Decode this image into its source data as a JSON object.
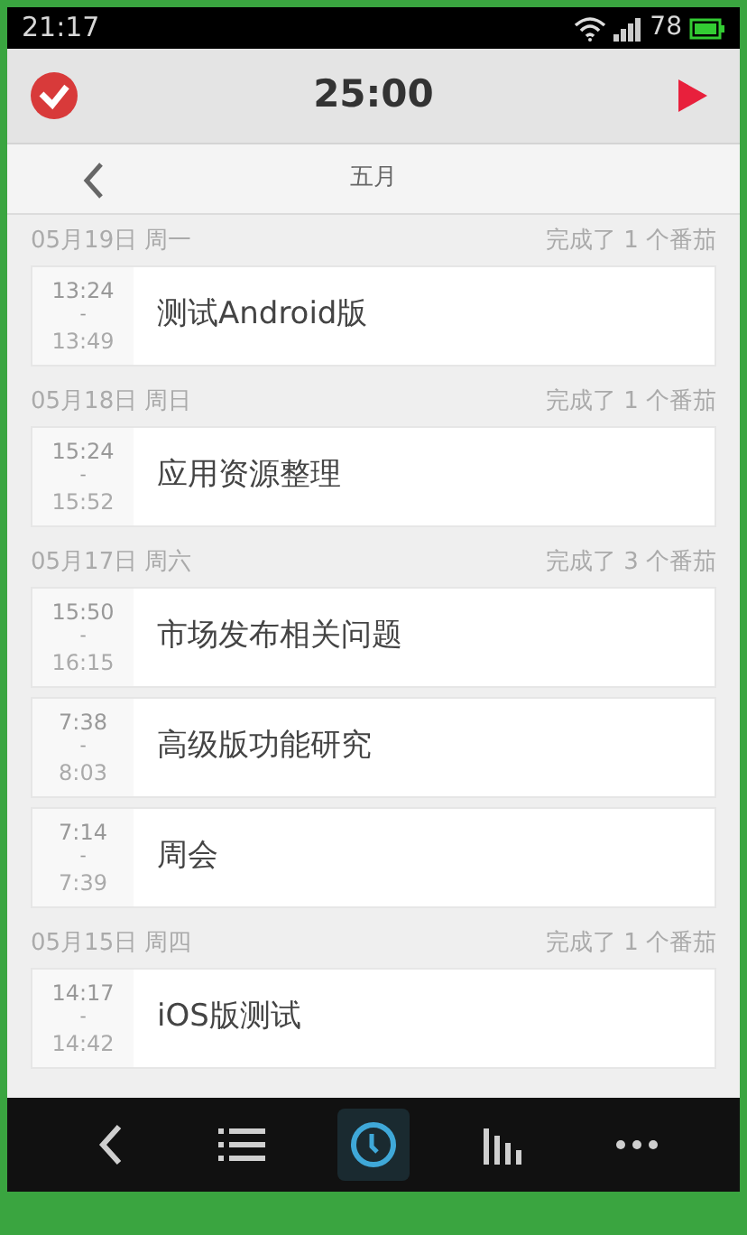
{
  "status_bar": {
    "time": "21:17",
    "battery": "78"
  },
  "header": {
    "timer": "25:00"
  },
  "month_bar": {
    "title": "五月"
  },
  "days": [
    {
      "date": "05月19日 周一",
      "summary": "完成了 1 个番茄",
      "tasks": [
        {
          "start": "13:24",
          "sep": "-",
          "end": "13:49",
          "title": "测试Android版"
        }
      ]
    },
    {
      "date": "05月18日 周日",
      "summary": "完成了 1 个番茄",
      "tasks": [
        {
          "start": "15:24",
          "sep": "-",
          "end": "15:52",
          "title": "应用资源整理"
        }
      ]
    },
    {
      "date": "05月17日 周六",
      "summary": "完成了 3 个番茄",
      "tasks": [
        {
          "start": "15:50",
          "sep": "-",
          "end": "16:15",
          "title": "市场发布相关问题"
        },
        {
          "start": "7:38",
          "sep": "-",
          "end": "8:03",
          "title": "高级版功能研究"
        },
        {
          "start": "7:14",
          "sep": "-",
          "end": "7:39",
          "title": "周会"
        }
      ]
    },
    {
      "date": "05月15日 周四",
      "summary": "完成了 1 个番茄",
      "tasks": [
        {
          "start": "14:17",
          "sep": "-",
          "end": "14:42",
          "title": "iOS版测试"
        }
      ]
    }
  ],
  "bottom_nav": [
    {
      "kind": "back",
      "selected": false
    },
    {
      "kind": "list",
      "selected": false
    },
    {
      "kind": "clock",
      "selected": true
    },
    {
      "kind": "stats",
      "selected": false
    },
    {
      "kind": "more",
      "selected": false
    }
  ]
}
